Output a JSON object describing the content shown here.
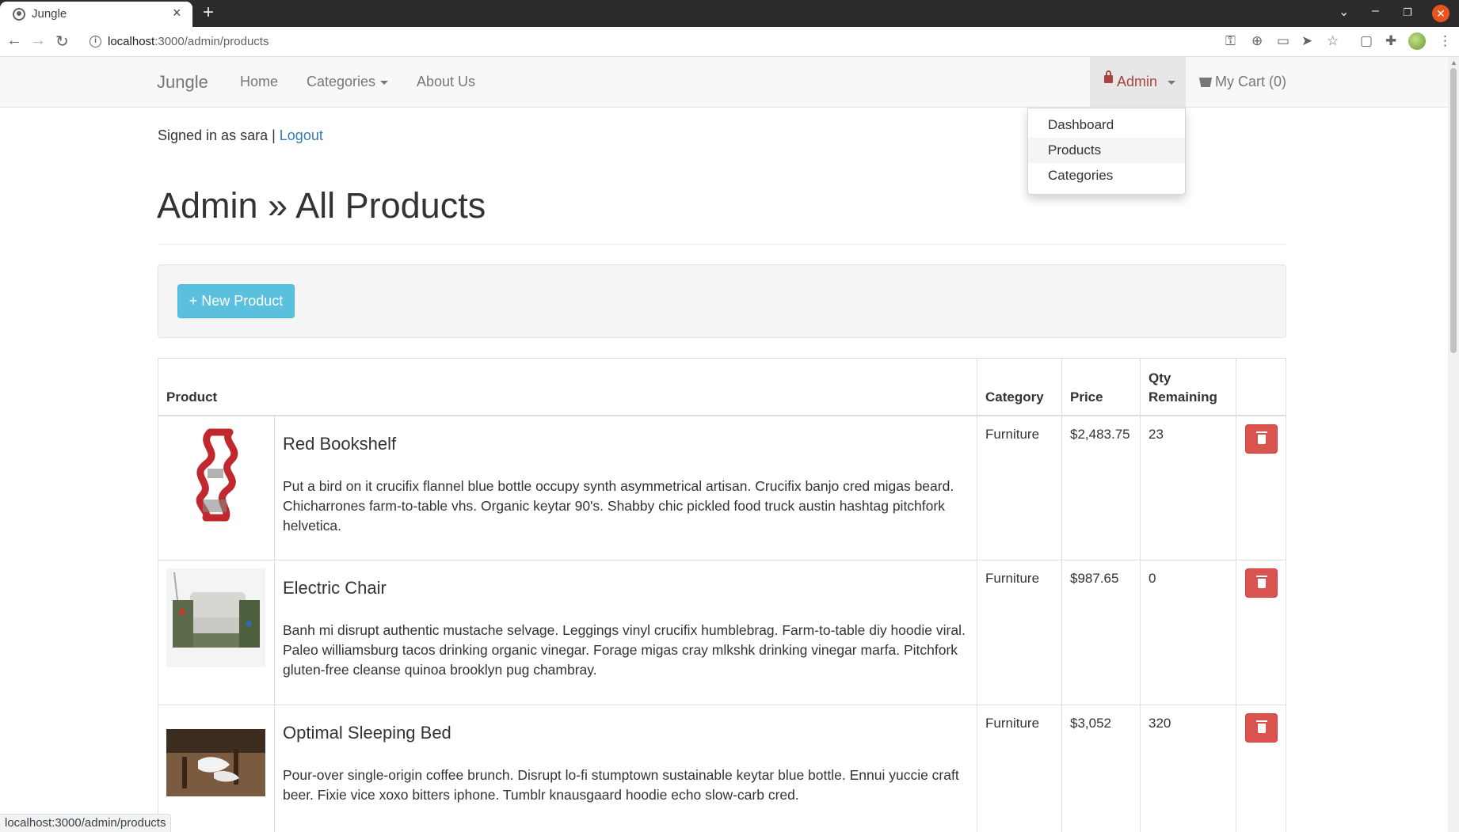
{
  "browser": {
    "tab_title": "Jungle",
    "url_host": "localhost",
    "url_path": ":3000/admin/products",
    "status_url": "localhost:3000/admin/products"
  },
  "navbar": {
    "brand": "Jungle",
    "home": "Home",
    "categories": "Categories",
    "about": "About Us",
    "admin": "Admin",
    "cart": "My Cart (0)"
  },
  "admin_menu": {
    "items": [
      "Dashboard",
      "Products",
      "Categories"
    ]
  },
  "session": {
    "signed_in_text": "Signed in as sara |",
    "logout": "Logout"
  },
  "page": {
    "title": "Admin » All Products",
    "new_product_button": "+ New Product"
  },
  "table": {
    "headers": {
      "product": "Product",
      "category": "Category",
      "price": "Price",
      "qty": "Qty Remaining"
    },
    "rows": [
      {
        "name": "Red Bookshelf",
        "description": "Put a bird on it crucifix flannel blue bottle occupy synth asymmetrical artisan. Crucifix banjo cred migas beard. Chicharrones farm-to-table vhs. Organic keytar 90's. Shabby chic pickled food truck austin hashtag pitchfork helvetica.",
        "category": "Furniture",
        "price": "$2,483.75",
        "qty": "23"
      },
      {
        "name": "Electric Chair",
        "description": "Banh mi disrupt authentic mustache selvage. Leggings vinyl crucifix humblebrag. Farm-to-table diy hoodie viral. Paleo williamsburg tacos drinking organic vinegar. Forage migas cray mlkshk drinking vinegar marfa. Pitchfork gluten-free cleanse quinoa brooklyn pug chambray.",
        "category": "Furniture",
        "price": "$987.65",
        "qty": "0"
      },
      {
        "name": "Optimal Sleeping Bed",
        "description": "Pour-over single-origin coffee brunch. Disrupt lo-fi stumptown sustainable keytar blue bottle. Ennui yuccie craft beer. Fixie vice xoxo bitters iphone. Tumblr knausgaard hoodie echo slow-carb cred.",
        "category": "Furniture",
        "price": "$3,052",
        "qty": "320"
      }
    ]
  },
  "colors": {
    "admin_accent": "#a94442",
    "link": "#337ab7",
    "info_button": "#5bc0de",
    "danger_button": "#d9534f"
  }
}
